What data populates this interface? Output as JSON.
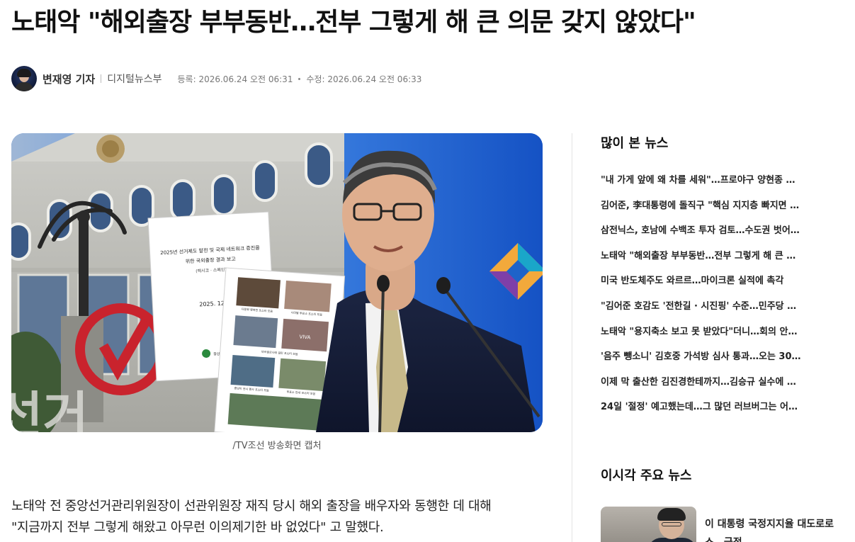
{
  "article": {
    "headline": "노태악 \"해외출장 부부동반…전부 그렇게 해 큰 의문 갖지 않았다\"",
    "reporter": "변재영 기자",
    "department": "디지털뉴스부",
    "registered": "등록: 2026.06.24 오전 06:31",
    "modified": "수정: 2026.06.24 오전 06:33",
    "image_caption": "/TV조선 방송화면 캡처",
    "body_lines": [
      "노태악 전 중앙선거관리위원장이 선관위원장 재직 당시 해외 출장을 배우자와 동행한 데 대해",
      "\"지금까지 전부 그렇게 해왔고 아무런 이의제기한 바 없었다\" 고 말했다."
    ]
  },
  "hero_image": {
    "report_title_line1": "2025년 선거제도 발전 및 국제 네트워크 증진을",
    "report_title_line2": "위한 국외출장 결과 보고",
    "report_sub": "(멕시코 · 스페인)",
    "report_date": "2025. 12.",
    "report_org": "중앙선거관리위원회",
    "photo_label_1": "다문화 행복한 포스터 모음",
    "photo_label_2": "나라별 투표소 포스터 모음",
    "photo_label_3": "바르셀로나에 걸린 포스터 모음",
    "photo_label_4": "중남미 전시 행사 포스터 모음",
    "photo_label_5": "투표소 안내 포스터 모음",
    "photo_label_6": "VIVA"
  },
  "sidebar": {
    "most_viewed_title": "많이 본 뉴스",
    "most_viewed": [
      "\"내 가게 앞에 왜 차를 세워\"…프로야구 양현종 …",
      "김어준, 李대통령에 돌직구 \"핵심 지지층 빠지면 …",
      "삼전닉스, 호남에 수백조 투자 검토…수도권 벗어…",
      "노태악 \"해외출장 부부동반…전부 그렇게 해 큰 …",
      "미국 반도체주도 와르르…마이크론 실적에 촉각",
      "\"김어준 호감도 '전한길 · 시진핑' 수준…민주당 …",
      "노태악 \"용지축소 보고 못 받았다\"더니…회의 안…",
      "'음주 뺑소니' 김호중 가석방 심사 통과…오는 30…",
      "이제 막 출산한 김진경한테까지…김승규 실수에 …",
      "24일 '절정' 예고했는데…그 많던 러브버그는 어…"
    ],
    "top_news_title": "이시각 주요 뉴스",
    "top_news": [
      {
        "title": "이 대통령 국정지지율 대도로로스…긍정…"
      }
    ]
  }
}
